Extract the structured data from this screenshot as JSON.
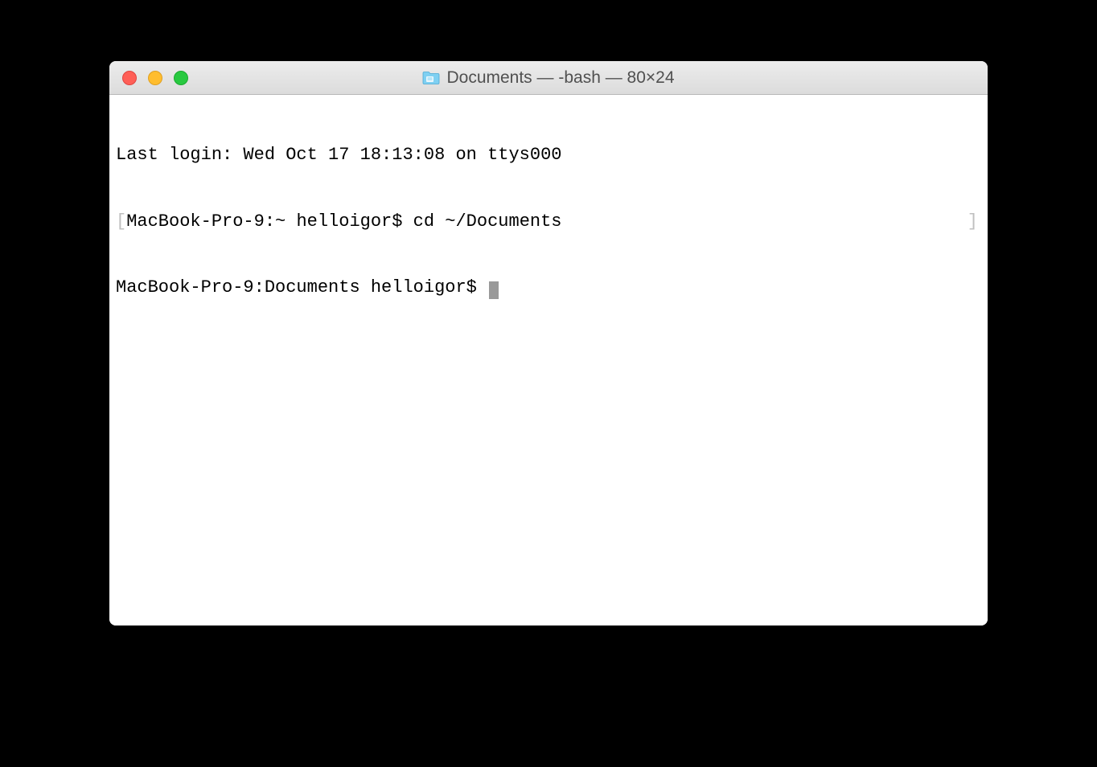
{
  "window": {
    "title": "Documents — -bash — 80×24"
  },
  "terminal": {
    "lines": {
      "last_login": "Last login: Wed Oct 17 18:13:08 on ttys000",
      "prompt1": "MacBook-Pro-9:~ helloigor$ ",
      "command1": "cd ~/Documents",
      "prompt2": "MacBook-Pro-9:Documents helloigor$ "
    }
  }
}
